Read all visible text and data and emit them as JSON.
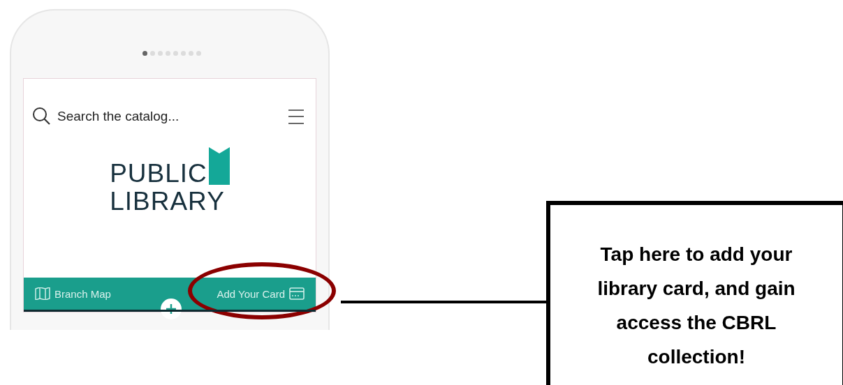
{
  "phone": {
    "page_dots": [
      {
        "selected": true
      },
      {
        "selected": false
      },
      {
        "selected": false
      },
      {
        "selected": false
      },
      {
        "selected": false
      },
      {
        "selected": false
      },
      {
        "selected": false
      },
      {
        "selected": false
      }
    ],
    "search": {
      "placeholder": "Search the catalog..."
    },
    "logo": {
      "lines": [
        "PUBLIC",
        "LIBRARY"
      ]
    },
    "bottom_bar": [
      {
        "kind": "map",
        "label": "Branch Map"
      },
      {
        "kind": "card",
        "label": "Add Your Card",
        "highlighted": true
      }
    ]
  },
  "callout": {
    "text": "Tap here to add your library card, and gain access the CBRL collection!"
  }
}
